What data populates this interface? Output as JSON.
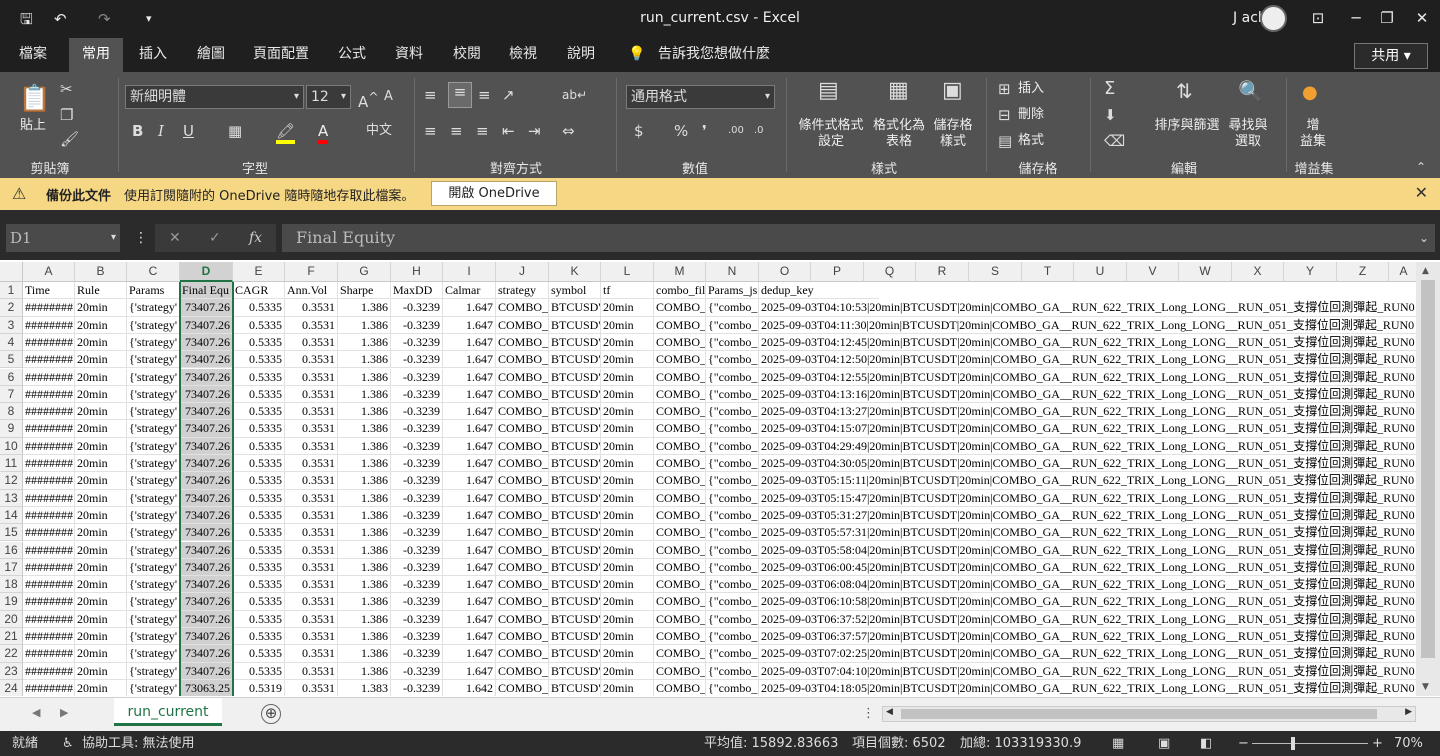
{
  "window": {
    "title": "run_current.csv - Excel",
    "user": "J ack",
    "qat": {
      "save": "🖫",
      "undo": "↶",
      "redo": "↷",
      "customize": "▾"
    },
    "controls": {
      "ribbon_display": "⊡",
      "minimize": "─",
      "restore": "❐",
      "close": "✕"
    }
  },
  "ribbon": {
    "tabs": [
      "檔案",
      "常用",
      "插入",
      "繪圖",
      "頁面配置",
      "公式",
      "資料",
      "校閱",
      "檢視",
      "說明"
    ],
    "active_tab": "常用",
    "tell_me": "告訴我您想做什麼",
    "share": "共用",
    "clipboard": {
      "paste": "貼上",
      "label": "剪貼簿"
    },
    "font": {
      "name": "新細明體",
      "size": "12",
      "bold": "B",
      "italic": "I",
      "underline": "U",
      "label": "字型"
    },
    "alignment": {
      "label": "對齊方式"
    },
    "number": {
      "format": "通用格式",
      "currency": "$",
      "percent": "%",
      "comma": "❜",
      "label": "數值"
    },
    "styles": {
      "conditional": "條件式格式",
      "conditional2": "設定",
      "as_table": "格式化為",
      "as_table2": "表格",
      "cell_styles": "儲存格",
      "cell_styles2": "樣式",
      "label": "樣式"
    },
    "cells": {
      "insert": "插入",
      "delete": "刪除",
      "format": "格式",
      "label": "儲存格"
    },
    "editing": {
      "sort": "排序與篩選",
      "find": "尋找與",
      "find2": "選取",
      "label": "編輯"
    },
    "addins": {
      "addin": "增",
      "addin2": "益集",
      "label": "增益集"
    }
  },
  "notification": {
    "title": "備份此文件",
    "message": "使用訂閱隨附的 OneDrive 隨時隨地存取此檔案。",
    "button": "開啟 OneDrive"
  },
  "formula_bar": {
    "name_box": "D1",
    "cancel": "✕",
    "enter": "✓",
    "fx": "fx",
    "content": "Final Equity"
  },
  "grid": {
    "columns": [
      "A",
      "B",
      "C",
      "D",
      "E",
      "F",
      "G",
      "H",
      "I",
      "J",
      "K",
      "L",
      "M",
      "N",
      "O",
      "P",
      "Q",
      "R",
      "S",
      "T",
      "U",
      "V",
      "W",
      "X",
      "Y",
      "Z",
      "A"
    ],
    "selected_column": "D",
    "header_row": [
      "Time",
      "Rule",
      "Params",
      "Final Equ",
      "CAGR",
      "Ann.Vol",
      "Sharpe",
      "MaxDD",
      "Calmar",
      "strategy",
      "symbol",
      "tf",
      "combo_fil",
      "Params_js",
      "dedup_key"
    ],
    "rows": [
      {
        "n": "2",
        "ts": "2025-09-03T04:10:53|20min|BTCUSDT|20min|COMBO_GA__RUN_622_TRIX_Long_LONG__RUN_051_支撐位回測彈起_RUN0"
      },
      {
        "n": "3",
        "ts": "2025-09-03T04:11:30|20min|BTCUSDT|20min|COMBO_GA__RUN_622_TRIX_Long_LONG__RUN_051_支撐位回測彈起_RUN0"
      },
      {
        "n": "4",
        "ts": "2025-09-03T04:12:45|20min|BTCUSDT|20min|COMBO_GA__RUN_622_TRIX_Long_LONG__RUN_051_支撐位回測彈起_RUN0"
      },
      {
        "n": "5",
        "ts": "2025-09-03T04:12:50|20min|BTCUSDT|20min|COMBO_GA__RUN_622_TRIX_Long_LONG__RUN_051_支撐位回測彈起_RUN0"
      },
      {
        "n": "6",
        "ts": "2025-09-03T04:12:55|20min|BTCUSDT|20min|COMBO_GA__RUN_622_TRIX_Long_LONG__RUN_051_支撐位回測彈起_RUN0"
      },
      {
        "n": "7",
        "ts": "2025-09-03T04:13:16|20min|BTCUSDT|20min|COMBO_GA__RUN_622_TRIX_Long_LONG__RUN_051_支撐位回測彈起_RUN0"
      },
      {
        "n": "8",
        "ts": "2025-09-03T04:13:27|20min|BTCUSDT|20min|COMBO_GA__RUN_622_TRIX_Long_LONG__RUN_051_支撐位回測彈起_RUN0"
      },
      {
        "n": "9",
        "ts": "2025-09-03T04:15:07|20min|BTCUSDT|20min|COMBO_GA__RUN_622_TRIX_Long_LONG__RUN_051_支撐位回測彈起_RUN0"
      },
      {
        "n": "10",
        "ts": "2025-09-03T04:29:49|20min|BTCUSDT|20min|COMBO_GA__RUN_622_TRIX_Long_LONG__RUN_051_支撐位回測彈起_RUN0"
      },
      {
        "n": "11",
        "ts": "2025-09-03T04:30:05|20min|BTCUSDT|20min|COMBO_GA__RUN_622_TRIX_Long_LONG__RUN_051_支撐位回測彈起_RUN0"
      },
      {
        "n": "12",
        "ts": "2025-09-03T05:15:11|20min|BTCUSDT|20min|COMBO_GA__RUN_622_TRIX_Long_LONG__RUN_051_支撐位回測彈起_RUN0"
      },
      {
        "n": "13",
        "ts": "2025-09-03T05:15:47|20min|BTCUSDT|20min|COMBO_GA__RUN_622_TRIX_Long_LONG__RUN_051_支撐位回測彈起_RUN0"
      },
      {
        "n": "14",
        "ts": "2025-09-03T05:31:27|20min|BTCUSDT|20min|COMBO_GA__RUN_622_TRIX_Long_LONG__RUN_051_支撐位回測彈起_RUN0"
      },
      {
        "n": "15",
        "ts": "2025-09-03T05:57:31|20min|BTCUSDT|20min|COMBO_GA__RUN_622_TRIX_Long_LONG__RUN_051_支撐位回測彈起_RUN0"
      },
      {
        "n": "16",
        "ts": "2025-09-03T05:58:04|20min|BTCUSDT|20min|COMBO_GA__RUN_622_TRIX_Long_LONG__RUN_051_支撐位回測彈起_RUN0"
      },
      {
        "n": "17",
        "ts": "2025-09-03T06:00:45|20min|BTCUSDT|20min|COMBO_GA__RUN_622_TRIX_Long_LONG__RUN_051_支撐位回測彈起_RUN0"
      },
      {
        "n": "18",
        "ts": "2025-09-03T06:08:04|20min|BTCUSDT|20min|COMBO_GA__RUN_622_TRIX_Long_LONG__RUN_051_支撐位回測彈起_RUN0"
      },
      {
        "n": "19",
        "ts": "2025-09-03T06:10:58|20min|BTCUSDT|20min|COMBO_GA__RUN_622_TRIX_Long_LONG__RUN_051_支撐位回測彈起_RUN0"
      },
      {
        "n": "20",
        "ts": "2025-09-03T06:37:52|20min|BTCUSDT|20min|COMBO_GA__RUN_622_TRIX_Long_LONG__RUN_051_支撐位回測彈起_RUN0"
      },
      {
        "n": "21",
        "ts": "2025-09-03T06:37:57|20min|BTCUSDT|20min|COMBO_GA__RUN_622_TRIX_Long_LONG__RUN_051_支撐位回測彈起_RUN0"
      },
      {
        "n": "22",
        "ts": "2025-09-03T07:02:25|20min|BTCUSDT|20min|COMBO_GA__RUN_622_TRIX_Long_LONG__RUN_051_支撐位回測彈起_RUN0"
      },
      {
        "n": "23",
        "ts": "2025-09-03T07:04:10|20min|BTCUSDT|20min|COMBO_GA__RUN_622_TRIX_Long_LONG__RUN_051_支撐位回測彈起_RUN0"
      },
      {
        "n": "24",
        "ts": "2025-09-03T04:18:05|20min|BTCUSDT|20min|COMBO_GA__RUN_622_TRIX_Long_LONG__RUN_051_支撐位回測彈起_RUN0"
      }
    ],
    "data_row": {
      "time": "########",
      "rule": "20min",
      "params": "{'strategy'",
      "equity": "73407.26",
      "cagr": "0.5335",
      "vol": "0.3531",
      "sharpe": "1.386",
      "maxdd": "-0.3239",
      "calmar": "1.647",
      "strategy": "COMBO_",
      "symbol": "BTCUSD'",
      "tf": "20min",
      "combo": "COMBO_",
      "pjs": "{\"combo_"
    },
    "last_row": {
      "equity": "73063.25",
      "cagr": "0.5319",
      "sharpe": "1.383",
      "calmar": "1.642"
    }
  },
  "sheets": {
    "tabs": [
      "run_current"
    ],
    "add": "⊕",
    "options": "⋮"
  },
  "status": {
    "mode": "就緒",
    "accessibility": "協助工具: 無法使用",
    "average": "平均值: 15892.83663",
    "count": "項目個數: 6502",
    "sum": "加總: 103319330.9",
    "zoom": "70%",
    "zoom_minus": "−",
    "zoom_plus": "+"
  }
}
